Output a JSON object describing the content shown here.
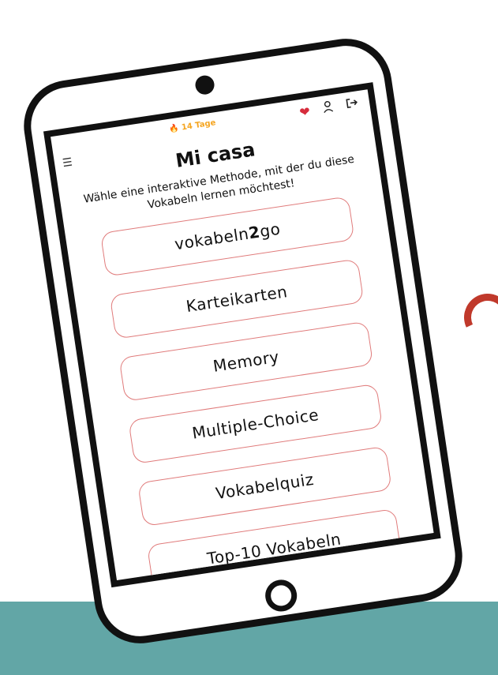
{
  "status": {
    "streak": "🔥 14 Tage"
  },
  "icons": {
    "heart": "heart-icon",
    "user": "user-icon",
    "logout": "logout-icon",
    "menu": "menu-icon"
  },
  "page": {
    "title": "Mi casa",
    "subtitle": "Wähle eine interaktive Methode, mit der du diese Vokabeln lernen möchtest!"
  },
  "methods": {
    "vokabeln2go": {
      "part1": "vokabeln",
      "part2": "2",
      "part3": "go"
    },
    "items": [
      "Karteikarten",
      "Memory",
      "Multiple-Choice",
      "Vokabelquiz",
      "Top-10 Vokabeln"
    ]
  },
  "colors": {
    "accent_border": "#e07b7b",
    "streak": "#f5a623",
    "heart": "#d62c3c",
    "teal": "#62a6a6",
    "arc": "#c0392b"
  }
}
